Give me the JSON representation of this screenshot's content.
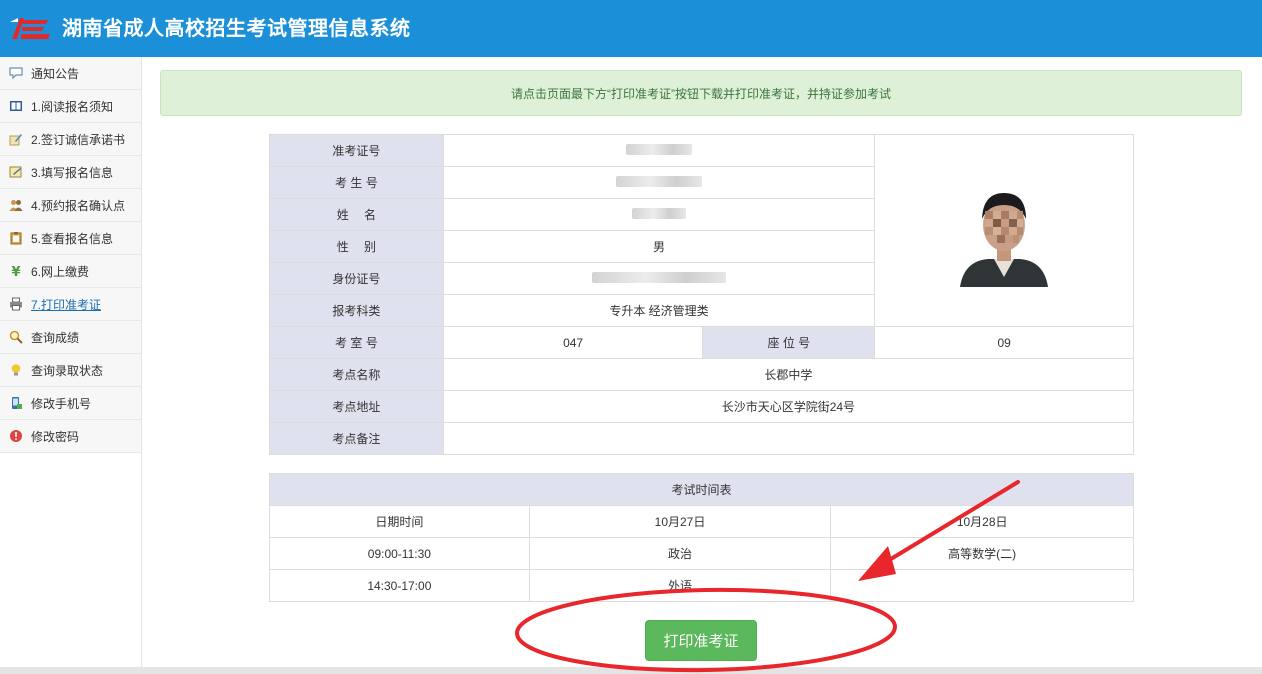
{
  "header": {
    "title": "湖南省成人高校招生考试管理信息系统"
  },
  "sidebar": {
    "items": [
      {
        "label": "通知公告",
        "icon": "chat-bubble-icon"
      },
      {
        "label": "1.阅读报名须知",
        "icon": "book-icon"
      },
      {
        "label": "2.签订诚信承诺书",
        "icon": "pen-sign-icon"
      },
      {
        "label": "3.填写报名信息",
        "icon": "form-edit-icon"
      },
      {
        "label": "4.预约报名确认点",
        "icon": "people-icon"
      },
      {
        "label": "5.查看报名信息",
        "icon": "clipboard-icon"
      },
      {
        "label": "6.网上缴费",
        "icon": "yen-icon"
      },
      {
        "label": "7.打印准考证",
        "icon": "printer-icon",
        "active": true
      },
      {
        "label": "查询成绩",
        "icon": "search-icon"
      },
      {
        "label": "查询录取状态",
        "icon": "lightbulb-icon"
      },
      {
        "label": "修改手机号",
        "icon": "phone-icon"
      },
      {
        "label": "修改密码",
        "icon": "alert-icon"
      }
    ]
  },
  "notice": "请点击页面最下方“打印准考证”按钮下载并打印准考证，并持证参加考试",
  "admission": {
    "exam_id_label": "准考证号",
    "candidate_no_label": "考 生 号",
    "name_label": "姓　 名",
    "gender_label": "性　 别",
    "gender_value": "男",
    "id_card_label": "身份证号",
    "category_label": "报考科类",
    "category_value": "专升本 经济管理类",
    "room_label": "考 室 号",
    "room_value": "047",
    "seat_label": "座 位 号",
    "seat_value": "09",
    "site_name_label": "考点名称",
    "site_name_value": "长郡中学",
    "site_address_label": "考点地址",
    "site_address_value": "长沙市天心区学院街24号",
    "site_note_label": "考点备注",
    "site_note_value": ""
  },
  "schedule": {
    "title": "考试时间表",
    "header": [
      "日期时间",
      "10月27日",
      "10月28日"
    ],
    "rows": [
      [
        "09:00-11:30",
        "政治",
        "高等数学(二)"
      ],
      [
        "14:30-17:00",
        "外语",
        ""
      ]
    ]
  },
  "print_button": "打印准考证",
  "colors": {
    "header": "#1b8fd8",
    "notice_bg": "#dff0d8",
    "button": "#5cb85c",
    "annotation": "#e8262b"
  }
}
